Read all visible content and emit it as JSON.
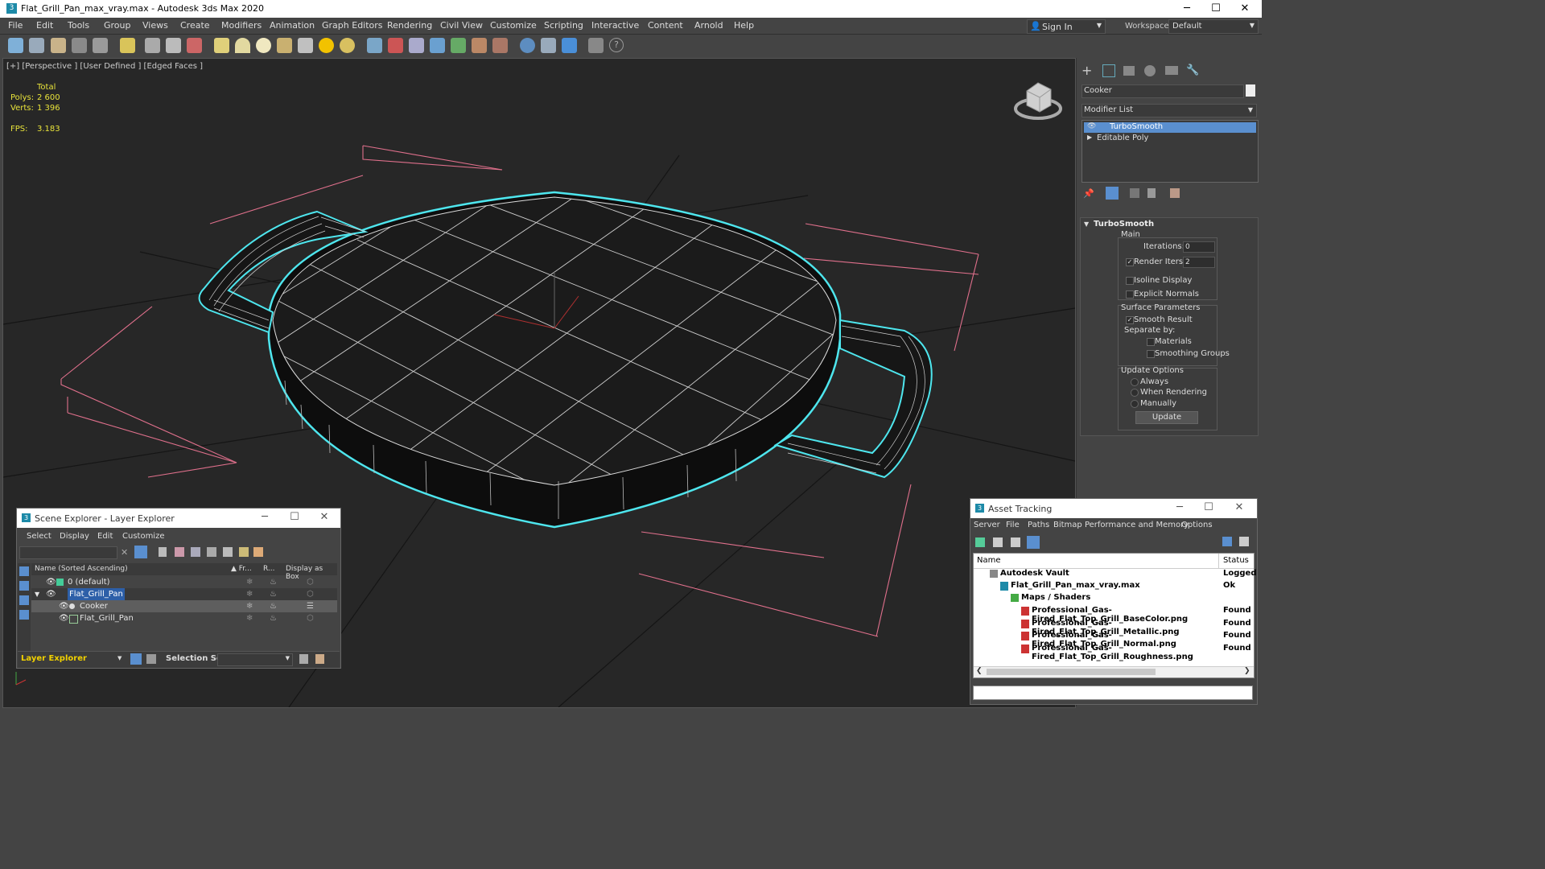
{
  "title_bar": {
    "app_icon_letter": "3",
    "title": "Flat_Grill_Pan_max_vray.max - Autodesk 3ds Max 2020",
    "min_glyph": "─",
    "max_glyph": "☐",
    "close_glyph": "✕"
  },
  "menu": [
    "File",
    "Edit",
    "Tools",
    "Group",
    "Views",
    "Create",
    "Modifiers",
    "Animation",
    "Graph Editors",
    "Rendering",
    "Civil View",
    "Customize",
    "Scripting",
    "Interactive",
    "Content",
    "Arnold",
    "Help"
  ],
  "account": {
    "sign_in": "Sign In",
    "workspaces_label": "Workspaces:",
    "workspace_value": "Default"
  },
  "viewport": {
    "label": "[+] [Perspective ] [User Defined ] [Edged Faces ]",
    "stats": {
      "total_label": "Total",
      "polys_label": "Polys:",
      "polys_value": "2 600",
      "verts_label": "Verts:",
      "verts_value": "1 396",
      "fps_label": "FPS:",
      "fps_value": "3.183"
    },
    "colors": {
      "bg": "#272727",
      "wire": "#ffffff",
      "selection": "#4ee6ee",
      "grid": "#111111",
      "bbox": "#e0708c"
    }
  },
  "command_panel": {
    "object_name": "Cooker",
    "modifier_list": "Modifier List",
    "stack": [
      {
        "label": "TurboSmooth",
        "selected": true
      },
      {
        "label": "Editable Poly",
        "selected": false
      }
    ],
    "rollout_title": "TurboSmooth",
    "main_label": "Main",
    "iterations_label": "Iterations:",
    "iterations_value": "0",
    "render_iters_label": "Render Iters:",
    "render_iters_value": "2",
    "isoline_label": "Isoline Display",
    "explicit_normals_label": "Explicit Normals",
    "surface_label": "Surface Parameters",
    "smooth_result_label": "Smooth Result",
    "separate_by_label": "Separate by:",
    "materials_label": "Materials",
    "smoothing_groups_label": "Smoothing Groups",
    "update_options_label": "Update Options",
    "always_label": "Always",
    "when_rendering_label": "When Rendering",
    "manually_label": "Manually",
    "update_button": "Update"
  },
  "scene_explorer": {
    "title": "Scene Explorer - Layer Explorer",
    "icon_letter": "3",
    "menu": [
      "Select",
      "Display",
      "Edit",
      "Customize"
    ],
    "col_name": "Name (Sorted Ascending)",
    "col_sort": "▲ Fr...",
    "col_r": "R...",
    "col_box": "Display as Box",
    "rows": [
      {
        "name": "0 (default)",
        "highlight": false,
        "selected": false
      },
      {
        "name": "Flat_Grill_Pan",
        "highlight": true,
        "selected": false
      },
      {
        "name": "Cooker",
        "highlight": false,
        "selected": true
      },
      {
        "name": "Flat_Grill_Pan",
        "highlight": false,
        "selected": false
      }
    ],
    "footer_label": "Layer Explorer",
    "selection_set_label": "Selection Set:"
  },
  "asset_tracking": {
    "title": "Asset Tracking",
    "icon_letter": "3",
    "menu": [
      "Server",
      "File",
      "Paths",
      "Bitmap Performance and Memory",
      "Options"
    ],
    "col_name": "Name",
    "col_status": "Status",
    "rows": [
      {
        "name": "Autodesk Vault",
        "status": "Logged",
        "indent": 0
      },
      {
        "name": "Flat_Grill_Pan_max_vray.max",
        "status": "Ok",
        "indent": 1
      },
      {
        "name": "Maps / Shaders",
        "status": "",
        "indent": 2
      },
      {
        "name": "Professional_Gas-Fired_Flat_Top_Grill_BaseColor.png",
        "status": "Found",
        "indent": 3
      },
      {
        "name": "Professional_Gas-Fired_Flat_Top_Grill_Metallic.png",
        "status": "Found",
        "indent": 3
      },
      {
        "name": "Professional_Gas-Fired_Flat_Top_Grill_Normal.png",
        "status": "Found",
        "indent": 3
      },
      {
        "name": "Professional_Gas-Fired_Flat_Top_Grill_Roughness.png",
        "status": "Found",
        "indent": 3
      }
    ]
  }
}
